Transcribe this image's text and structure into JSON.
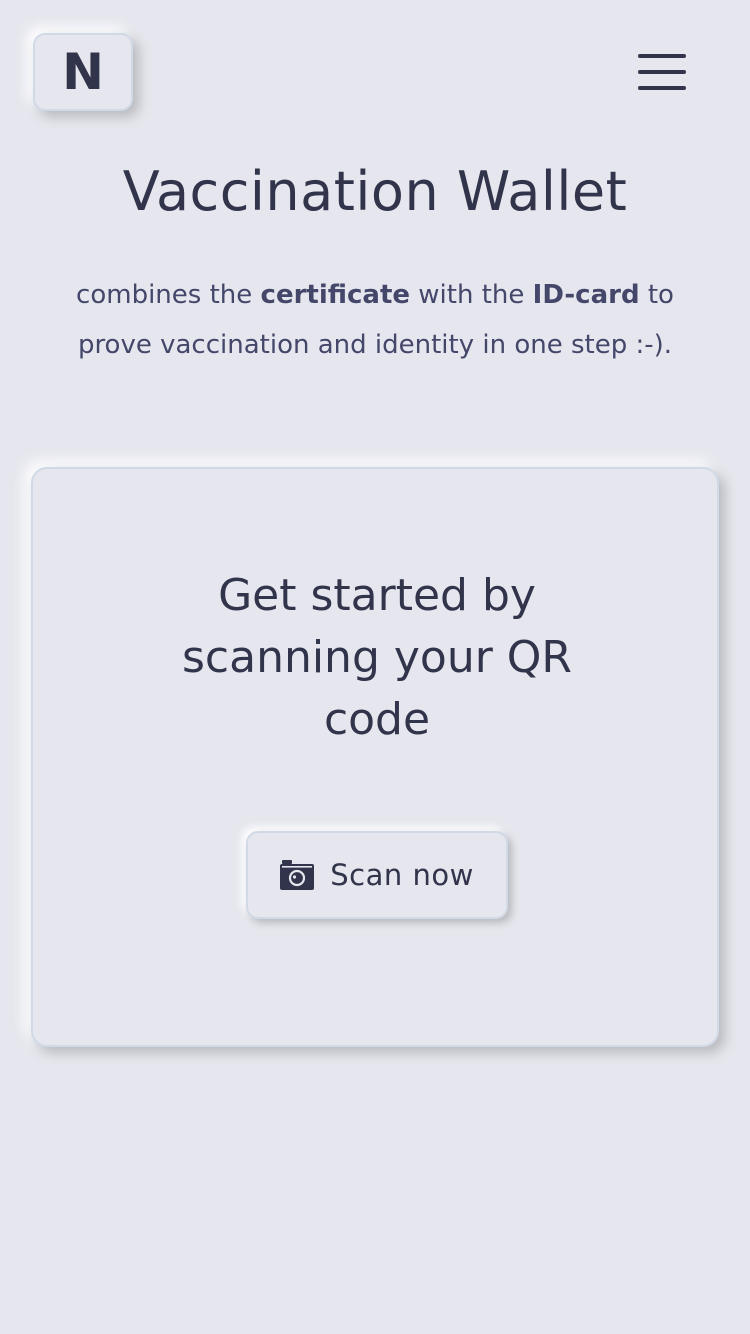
{
  "header": {
    "logo_letter": "N",
    "menu_icon": "hamburger-menu-icon"
  },
  "hero": {
    "title": "Vaccination Wallet",
    "subtitle_part1": "combines the ",
    "subtitle_bold1": "certificate",
    "subtitle_part2": " with the ",
    "subtitle_bold2": "ID-card",
    "subtitle_part3": " to prove vaccination and identity in one step :-)."
  },
  "card": {
    "heading": "Get started by scanning your QR code",
    "scan_button_label": "Scan now",
    "scan_button_icon": "camera-icon"
  },
  "colors": {
    "background": "#e6e7ee",
    "text_primary": "#31344b",
    "text_secondary": "#44476a",
    "border": "#d1d9e6"
  }
}
